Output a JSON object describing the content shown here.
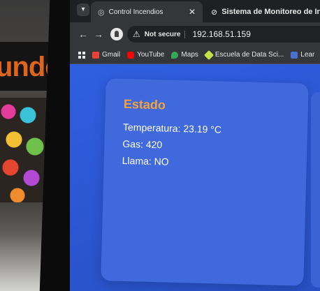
{
  "browser": {
    "tabs": [
      {
        "label": "Control Incendios",
        "active": true
      },
      {
        "label": "Sistema de Monitoreo de Inc",
        "active": false
      }
    ],
    "address_bar": {
      "security_label": "Not secure",
      "url": "192.168.51.159"
    },
    "bookmarks": [
      {
        "label": "Gmail",
        "icon": "gmail-icon"
      },
      {
        "label": "YouTube",
        "icon": "youtube-icon"
      },
      {
        "label": "Maps",
        "icon": "maps-icon"
      },
      {
        "label": "Escuela de Data Sci...",
        "icon": "bookmark-icon"
      },
      {
        "label": "Lear",
        "icon": "bookmark-icon"
      }
    ]
  },
  "status_card": {
    "title": "Estado",
    "temperature": "Temperatura: 23.19 °C",
    "gas": "Gas: 420",
    "flame": "Llama: NO"
  },
  "background": {
    "sign_text": "unde"
  },
  "colors": {
    "page_background": "#2d5bd6",
    "card_background": "#4169de",
    "card_title": "#f2a33a",
    "card_text": "#ffffff"
  }
}
